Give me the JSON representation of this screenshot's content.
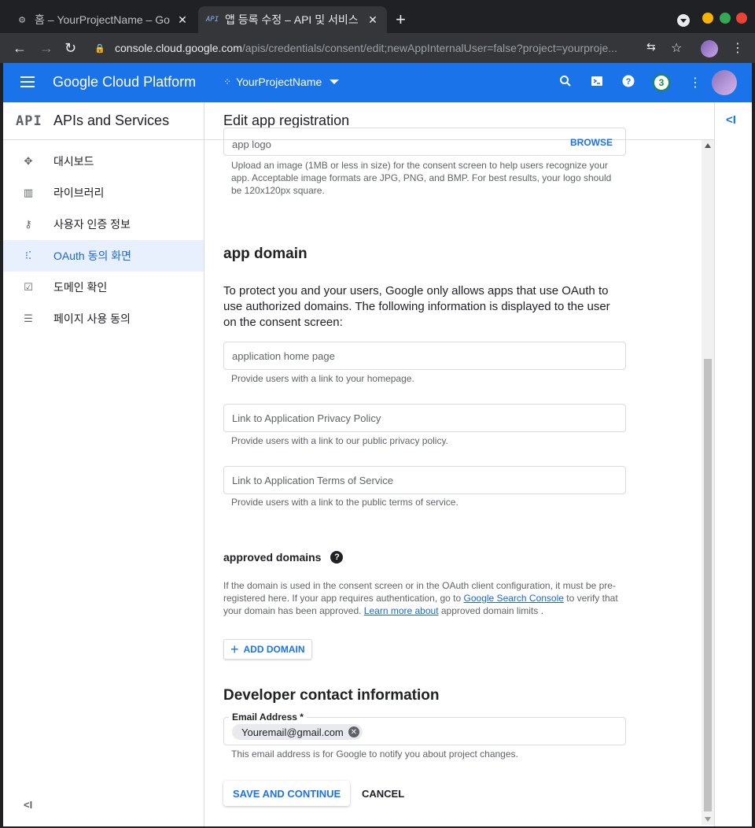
{
  "browser": {
    "tabs": [
      {
        "title": "홈 – YourProjectName – Go",
        "active": false,
        "favicon": "gear-icon"
      },
      {
        "title": "앱 등록 수정 – API 및 서비스",
        "active": true,
        "favicon": "API"
      }
    ],
    "url_host": "console.cloud.google.com",
    "url_path": "/apis/credentials/consent/edit;newAppInternalUser=false?project=yourproje..."
  },
  "header": {
    "brand": "Google Cloud Platform",
    "project": "YourProjectName",
    "notifications": "3"
  },
  "sidebar": {
    "logo": "API",
    "title": "APIs and Services",
    "items": [
      {
        "label": "대시보드",
        "icon": "dashboard-icon",
        "active": false
      },
      {
        "label": "라이브러리",
        "icon": "library-icon",
        "active": false
      },
      {
        "label": "사용자 인증 정보",
        "icon": "key-icon",
        "active": false
      },
      {
        "label": "OAuth 동의 화면",
        "icon": "oauth-icon",
        "active": true
      },
      {
        "label": "도메인 확인",
        "icon": "checkbox-icon",
        "active": false
      },
      {
        "label": "페이지 사용 동의",
        "icon": "settings-list-icon",
        "active": false
      }
    ]
  },
  "main": {
    "title": "Edit app registration",
    "app_logo": {
      "placeholder": "app logo",
      "browse": "BROWSE",
      "help": "Upload an image (1MB or less in size) for the consent screen to help users recognize your app. Acceptable image formats are JPG, PNG, and BMP. For best results, your logo should be 120x120px square."
    },
    "app_domain": {
      "heading": "app domain",
      "description": "To protect you and your users, Google only allows apps that use OAuth to use authorized domains. The following information is displayed to the user on the consent screen:",
      "home_placeholder": "application home page",
      "home_help": "Provide users with a link to your homepage.",
      "privacy_placeholder": "Link to Application Privacy Policy",
      "privacy_help": "Provide users with a link to our public privacy policy.",
      "tos_placeholder": "Link to Application Terms of Service",
      "tos_help": "Provide users with a link to the public terms of service."
    },
    "approved_domains": {
      "heading": "approved domains",
      "text_1": "If the domain is used in the consent screen or in the OAuth client configuration, it must be pre-registered here. If your app requires authentication, go to ",
      "link_1": "Google Search Console",
      "text_2": " to verify that your domain has been approved. ",
      "link_2": "Learn more about",
      "text_3": " approved domain limits .",
      "add_button": "ADD DOMAIN"
    },
    "developer": {
      "heading": "Developer contact information",
      "email_label": "Email Address *",
      "email_value": "Youremail@gmail.com",
      "help": "This email address is for Google to notify you about project changes."
    },
    "actions": {
      "save": "SAVE AND CONTINUE",
      "cancel": "CANCEL"
    }
  }
}
